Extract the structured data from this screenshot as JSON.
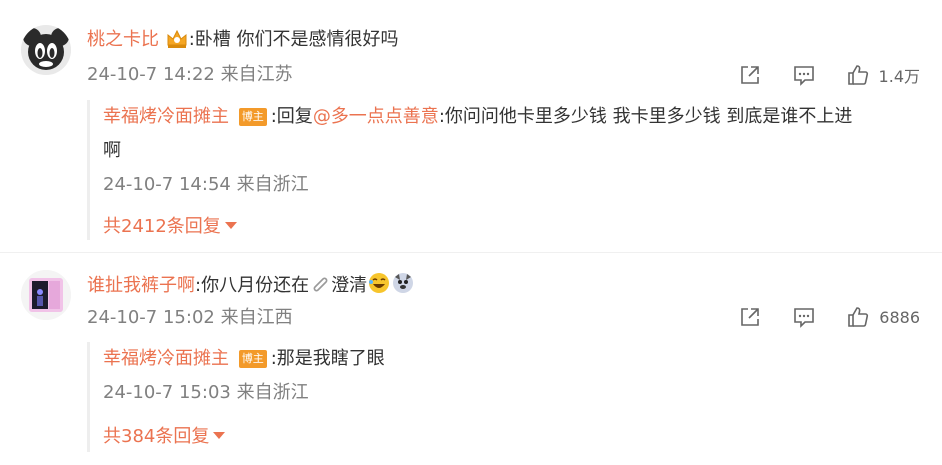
{
  "comments": [
    {
      "user": "桃之卡比",
      "text": ":卧槽 你们不是感情很好吗",
      "time_location": "24-10-7 14:22 来自江苏",
      "likes": "1.4万",
      "reply": {
        "user": "幸福烤冷面摊主",
        "badge": "博主",
        "prefix": ":回复",
        "mention": "@多一点点善意",
        "text_line1": ":你问问他卡里多少钱 我卡里多少钱 到底是谁不上进",
        "text_line2": "啊",
        "time_location": "24-10-7 14:54 来自浙江"
      },
      "more_replies": "共2412条回复"
    },
    {
      "user": "谁扯我裤子啊",
      "text_before": ":你八月份还在",
      "text_after": "澄清",
      "time_location": "24-10-7 15:02 来自江西",
      "likes": "6886",
      "reply": {
        "user": "幸福烤冷面摊主",
        "badge": "博主",
        "text": ":那是我瞎了眼",
        "time_location": "24-10-7 15:03 来自浙江"
      },
      "more_replies": "共384条回复"
    }
  ],
  "icons": {
    "share": "share-icon",
    "comment": "comment-icon",
    "like": "like-icon",
    "badge": "vip-crown-icon"
  },
  "colors": {
    "username": "#eb7350",
    "meta": "#808080",
    "badge": "#f39a2a"
  }
}
